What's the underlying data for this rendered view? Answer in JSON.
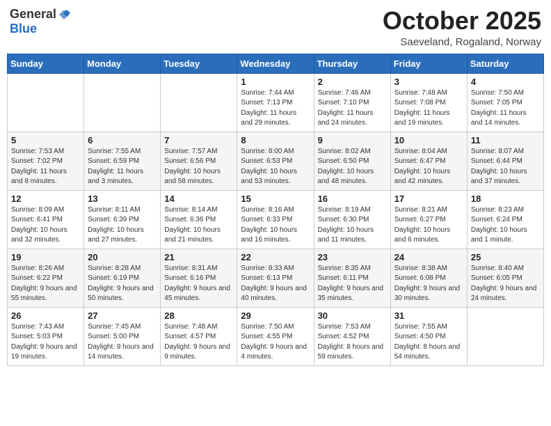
{
  "logo": {
    "general": "General",
    "blue": "Blue"
  },
  "title": {
    "month": "October 2025",
    "location": "Saeveland, Rogaland, Norway"
  },
  "headers": [
    "Sunday",
    "Monday",
    "Tuesday",
    "Wednesday",
    "Thursday",
    "Friday",
    "Saturday"
  ],
  "weeks": [
    [
      {
        "day": "",
        "info": ""
      },
      {
        "day": "",
        "info": ""
      },
      {
        "day": "",
        "info": ""
      },
      {
        "day": "1",
        "info": "Sunrise: 7:44 AM\nSunset: 7:13 PM\nDaylight: 11 hours\nand 29 minutes."
      },
      {
        "day": "2",
        "info": "Sunrise: 7:46 AM\nSunset: 7:10 PM\nDaylight: 11 hours\nand 24 minutes."
      },
      {
        "day": "3",
        "info": "Sunrise: 7:48 AM\nSunset: 7:08 PM\nDaylight: 11 hours\nand 19 minutes."
      },
      {
        "day": "4",
        "info": "Sunrise: 7:50 AM\nSunset: 7:05 PM\nDaylight: 11 hours\nand 14 minutes."
      }
    ],
    [
      {
        "day": "5",
        "info": "Sunrise: 7:53 AM\nSunset: 7:02 PM\nDaylight: 11 hours\nand 8 minutes."
      },
      {
        "day": "6",
        "info": "Sunrise: 7:55 AM\nSunset: 6:59 PM\nDaylight: 11 hours\nand 3 minutes."
      },
      {
        "day": "7",
        "info": "Sunrise: 7:57 AM\nSunset: 6:56 PM\nDaylight: 10 hours\nand 58 minutes."
      },
      {
        "day": "8",
        "info": "Sunrise: 8:00 AM\nSunset: 6:53 PM\nDaylight: 10 hours\nand 53 minutes."
      },
      {
        "day": "9",
        "info": "Sunrise: 8:02 AM\nSunset: 6:50 PM\nDaylight: 10 hours\nand 48 minutes."
      },
      {
        "day": "10",
        "info": "Sunrise: 8:04 AM\nSunset: 6:47 PM\nDaylight: 10 hours\nand 42 minutes."
      },
      {
        "day": "11",
        "info": "Sunrise: 8:07 AM\nSunset: 6:44 PM\nDaylight: 10 hours\nand 37 minutes."
      }
    ],
    [
      {
        "day": "12",
        "info": "Sunrise: 8:09 AM\nSunset: 6:41 PM\nDaylight: 10 hours\nand 32 minutes."
      },
      {
        "day": "13",
        "info": "Sunrise: 8:11 AM\nSunset: 6:39 PM\nDaylight: 10 hours\nand 27 minutes."
      },
      {
        "day": "14",
        "info": "Sunrise: 8:14 AM\nSunset: 6:36 PM\nDaylight: 10 hours\nand 21 minutes."
      },
      {
        "day": "15",
        "info": "Sunrise: 8:16 AM\nSunset: 6:33 PM\nDaylight: 10 hours\nand 16 minutes."
      },
      {
        "day": "16",
        "info": "Sunrise: 8:19 AM\nSunset: 6:30 PM\nDaylight: 10 hours\nand 11 minutes."
      },
      {
        "day": "17",
        "info": "Sunrise: 8:21 AM\nSunset: 6:27 PM\nDaylight: 10 hours\nand 6 minutes."
      },
      {
        "day": "18",
        "info": "Sunrise: 8:23 AM\nSunset: 6:24 PM\nDaylight: 10 hours\nand 1 minute."
      }
    ],
    [
      {
        "day": "19",
        "info": "Sunrise: 8:26 AM\nSunset: 6:22 PM\nDaylight: 9 hours\nand 55 minutes."
      },
      {
        "day": "20",
        "info": "Sunrise: 8:28 AM\nSunset: 6:19 PM\nDaylight: 9 hours\nand 50 minutes."
      },
      {
        "day": "21",
        "info": "Sunrise: 8:31 AM\nSunset: 6:16 PM\nDaylight: 9 hours\nand 45 minutes."
      },
      {
        "day": "22",
        "info": "Sunrise: 8:33 AM\nSunset: 6:13 PM\nDaylight: 9 hours\nand 40 minutes."
      },
      {
        "day": "23",
        "info": "Sunrise: 8:35 AM\nSunset: 6:11 PM\nDaylight: 9 hours\nand 35 minutes."
      },
      {
        "day": "24",
        "info": "Sunrise: 8:38 AM\nSunset: 6:08 PM\nDaylight: 9 hours\nand 30 minutes."
      },
      {
        "day": "25",
        "info": "Sunrise: 8:40 AM\nSunset: 6:05 PM\nDaylight: 9 hours\nand 24 minutes."
      }
    ],
    [
      {
        "day": "26",
        "info": "Sunrise: 7:43 AM\nSunset: 5:03 PM\nDaylight: 9 hours\nand 19 minutes."
      },
      {
        "day": "27",
        "info": "Sunrise: 7:45 AM\nSunset: 5:00 PM\nDaylight: 9 hours\nand 14 minutes."
      },
      {
        "day": "28",
        "info": "Sunrise: 7:48 AM\nSunset: 4:57 PM\nDaylight: 9 hours\nand 9 minutes."
      },
      {
        "day": "29",
        "info": "Sunrise: 7:50 AM\nSunset: 4:55 PM\nDaylight: 9 hours\nand 4 minutes."
      },
      {
        "day": "30",
        "info": "Sunrise: 7:53 AM\nSunset: 4:52 PM\nDaylight: 8 hours\nand 59 minutes."
      },
      {
        "day": "31",
        "info": "Sunrise: 7:55 AM\nSunset: 4:50 PM\nDaylight: 8 hours\nand 54 minutes."
      },
      {
        "day": "",
        "info": ""
      }
    ]
  ]
}
